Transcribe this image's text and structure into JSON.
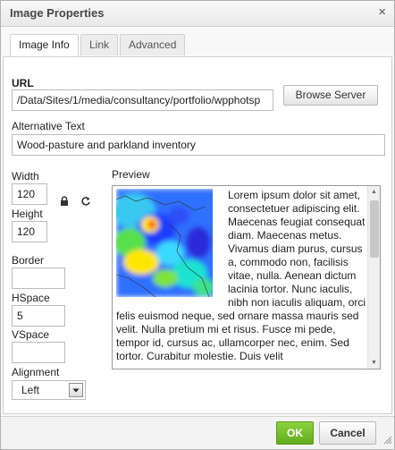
{
  "dialog": {
    "title": "Image Properties",
    "close_glyph": "×"
  },
  "tabs": [
    {
      "label": "Image Info",
      "active": true
    },
    {
      "label": "Link",
      "active": false
    },
    {
      "label": "Advanced",
      "active": false
    }
  ],
  "url": {
    "label": "URL",
    "value": "/Data/Sites/1/media/consultancy/portfolio/wpphotsp",
    "browse_label": "Browse Server"
  },
  "alt_text": {
    "label": "Alternative Text",
    "value": "Wood-pasture and parkland inventory"
  },
  "width": {
    "label": "Width",
    "value": "120"
  },
  "height": {
    "label": "Height",
    "value": "120"
  },
  "border": {
    "label": "Border",
    "value": ""
  },
  "hspace": {
    "label": "HSpace",
    "value": "5"
  },
  "vspace": {
    "label": "VSpace",
    "value": ""
  },
  "alignment": {
    "label": "Alignment",
    "value": "Left"
  },
  "preview": {
    "label": "Preview",
    "text": "Lorem ipsum dolor sit amet, consectetuer adipiscing elit. Maecenas feugiat consequat diam. Maecenas metus. Vivamus diam purus, cursus a, commodo non, facilisis vitae, nulla. Aenean dictum lacinia tortor. Nunc iaculis, nibh non iaculis aliquam, orci felis euismod neque, sed ornare massa mauris sed velit. Nulla pretium mi et risus. Fusce mi pede, tempor id, cursus ac, ullamcorper nec, enim. Sed tortor. Curabitur molestie. Duis velit"
  },
  "footer": {
    "ok_label": "OK",
    "cancel_label": "Cancel"
  },
  "colors": {
    "ok_green": "#6bb423",
    "border": "#b2b2b2"
  },
  "icons": [
    "close-icon",
    "lock-icon",
    "reset-icon",
    "chevron-down-icon",
    "resize-grip-icon"
  ]
}
